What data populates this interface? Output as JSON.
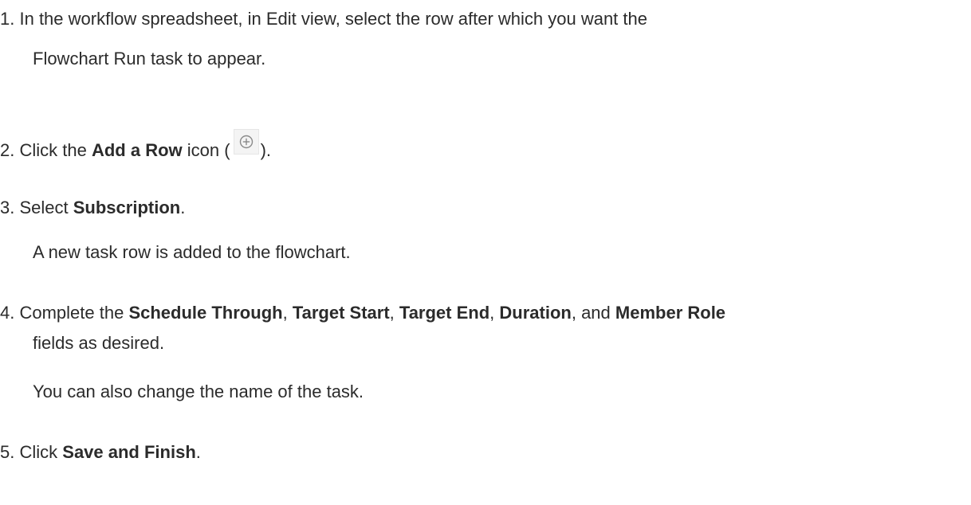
{
  "steps": [
    {
      "number": "1.",
      "line1": "In the workflow spreadsheet, in Edit view, select the row after which you want the",
      "line2": "Flowchart Run task to appear."
    },
    {
      "number": "2.",
      "prefix": "Click the ",
      "bold": "Add a Row",
      "middle": " icon (",
      "suffix": ").",
      "icon": "add-circle-icon"
    },
    {
      "number": "3.",
      "prefix": "Select ",
      "bold": "Subscription",
      "suffix": ".",
      "note": "A new task row is added to the flowchart."
    },
    {
      "number": "4.",
      "prefix": "Complete the ",
      "field1": "Schedule Through",
      "sep1": ", ",
      "field2": "Target Start",
      "sep2": ", ",
      "field3": "Target End",
      "sep3": ", ",
      "field4": "Duration",
      "sep4": ", and ",
      "field5": "Member Role",
      "line2": "fields as desired.",
      "note": "You can also change the name of the task."
    },
    {
      "number": "5.",
      "prefix": "Click ",
      "bold": "Save and Finish",
      "suffix": "."
    }
  ]
}
